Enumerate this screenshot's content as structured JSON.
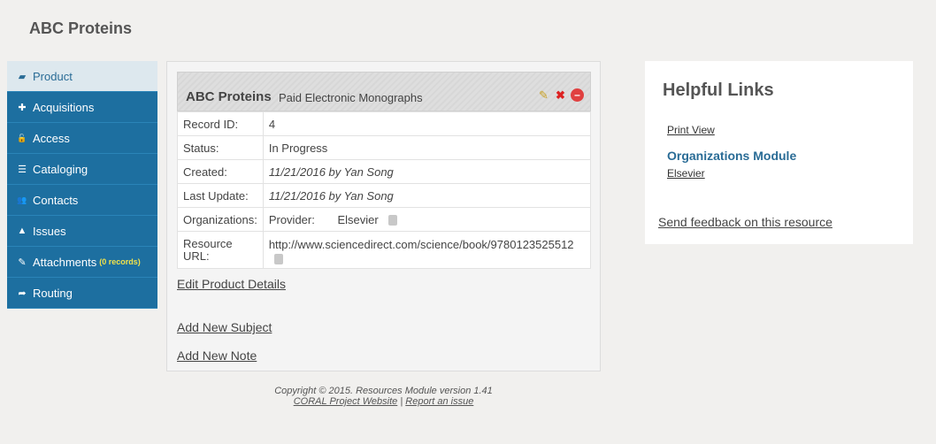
{
  "page": {
    "title": "ABC Proteins"
  },
  "sidebar": {
    "items": [
      {
        "label": "Product",
        "icon": "book-icon",
        "glyph": "▰"
      },
      {
        "label": "Acquisitions",
        "icon": "puzzle-icon",
        "glyph": "✚"
      },
      {
        "label": "Access",
        "icon": "lock-icon",
        "glyph": "🔓"
      },
      {
        "label": "Cataloging",
        "icon": "list-icon",
        "glyph": "☰"
      },
      {
        "label": "Contacts",
        "icon": "users-icon",
        "glyph": "👥"
      },
      {
        "label": "Issues",
        "icon": "warning-icon",
        "glyph": "▲"
      },
      {
        "label": "Attachments",
        "icon": "paperclip-icon",
        "glyph": "✎",
        "badge": "(0 records)"
      },
      {
        "label": "Routing",
        "icon": "share-icon",
        "glyph": "➦"
      }
    ]
  },
  "record": {
    "title": "ABC Proteins",
    "subtitle": "Paid Electronic Monographs",
    "rows": {
      "record_id_label": "Record ID:",
      "record_id": "4",
      "status_label": "Status:",
      "status": "In Progress",
      "created_label": "Created:",
      "created": "11/21/2016 by Yan Song",
      "last_update_label": "Last Update:",
      "last_update": "11/21/2016 by Yan Song",
      "organizations_label": "Organizations:",
      "org_role": "Provider:",
      "org_name": "Elsevier",
      "resource_url_label_1": "Resource",
      "resource_url_label_2": "URL:",
      "resource_url": "http://www.sciencedirect.com/science/book/9780123525512"
    }
  },
  "actions": {
    "edit_product": "Edit Product Details",
    "add_subject": "Add New Subject",
    "add_note": "Add New Note"
  },
  "footer": {
    "copyright": "Copyright © 2015. Resources Module version 1.41",
    "coral_link": "CORAL Project Website",
    "separator": "|",
    "report_link": "Report an issue"
  },
  "helpful": {
    "title": "Helpful Links",
    "print_view": "Print View",
    "org_module": "Organizations Module",
    "org_link": "Elsevier",
    "feedback": "Send feedback on this resource"
  }
}
